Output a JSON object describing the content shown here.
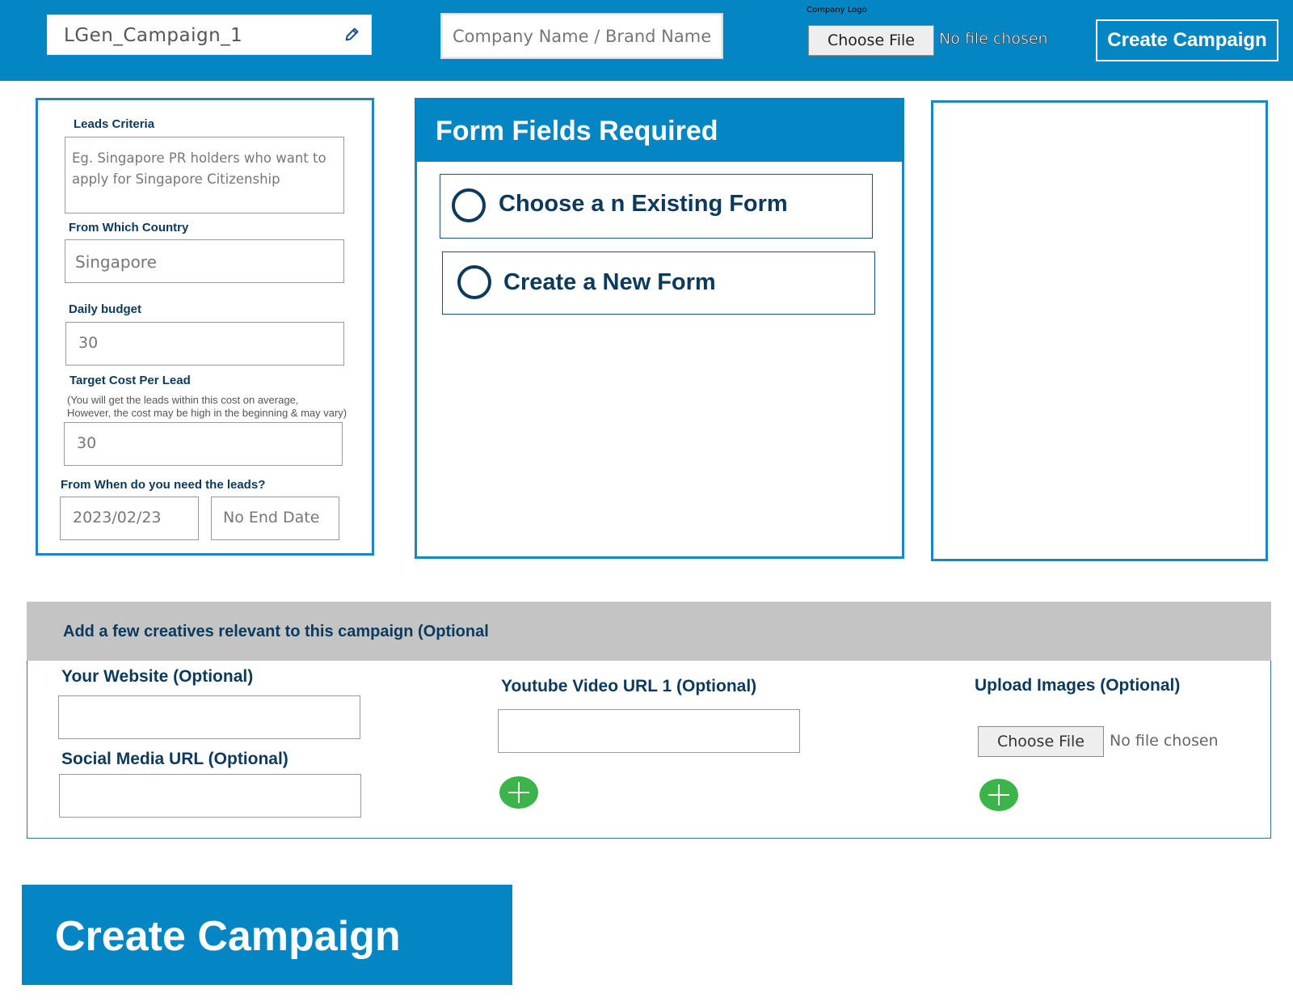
{
  "topbar": {
    "campaign_name": "LGen_Campaign_1",
    "edit_icon": "pencil-icon",
    "company_placeholder": "Company Name / Brand Name",
    "logo_label": "Company Logo",
    "choose_file_label": "Choose File",
    "no_file_text": "No file chosen",
    "create_label": "Create Campaign",
    "bar_color": "#0386c3"
  },
  "criteria": {
    "leads_label": "Leads Criteria",
    "leads_placeholder": "Eg. Singapore PR holders who want to apply for Singapore Citizenship",
    "country_label": "From Which Country",
    "country_value": "Singapore",
    "budget_label": "Daily budget",
    "budget_value": "30",
    "cpl_label": "Target Cost Per Lead",
    "cpl_note_1": "(You will get the leads within this cost on average,",
    "cpl_note_2": "However, the cost may be high in the beginning & may vary)",
    "cpl_value": "30",
    "when_label": "From When do you need the leads?",
    "start_date": "2023/02/23",
    "end_date": "No End Date"
  },
  "form_fields": {
    "title": "Form Fields Required",
    "option_existing": "Choose a n Existing Form",
    "option_new": "Create a New Form"
  },
  "creatives": {
    "header": "Add a few creatives relevant to this campaign (Optional",
    "website_label": "Your Website (Optional)",
    "social_label": "Social Media URL (Optional)",
    "youtube_label": "Youtube Video URL 1 (Optional)",
    "images_label": "Upload Images (Optional)",
    "choose_file_label": "Choose File",
    "no_file_text": "No file chosen",
    "add_icon": "plus-circle-icon",
    "add_color": "#3bb54a"
  },
  "footer": {
    "create_label": "Create Campaign"
  }
}
